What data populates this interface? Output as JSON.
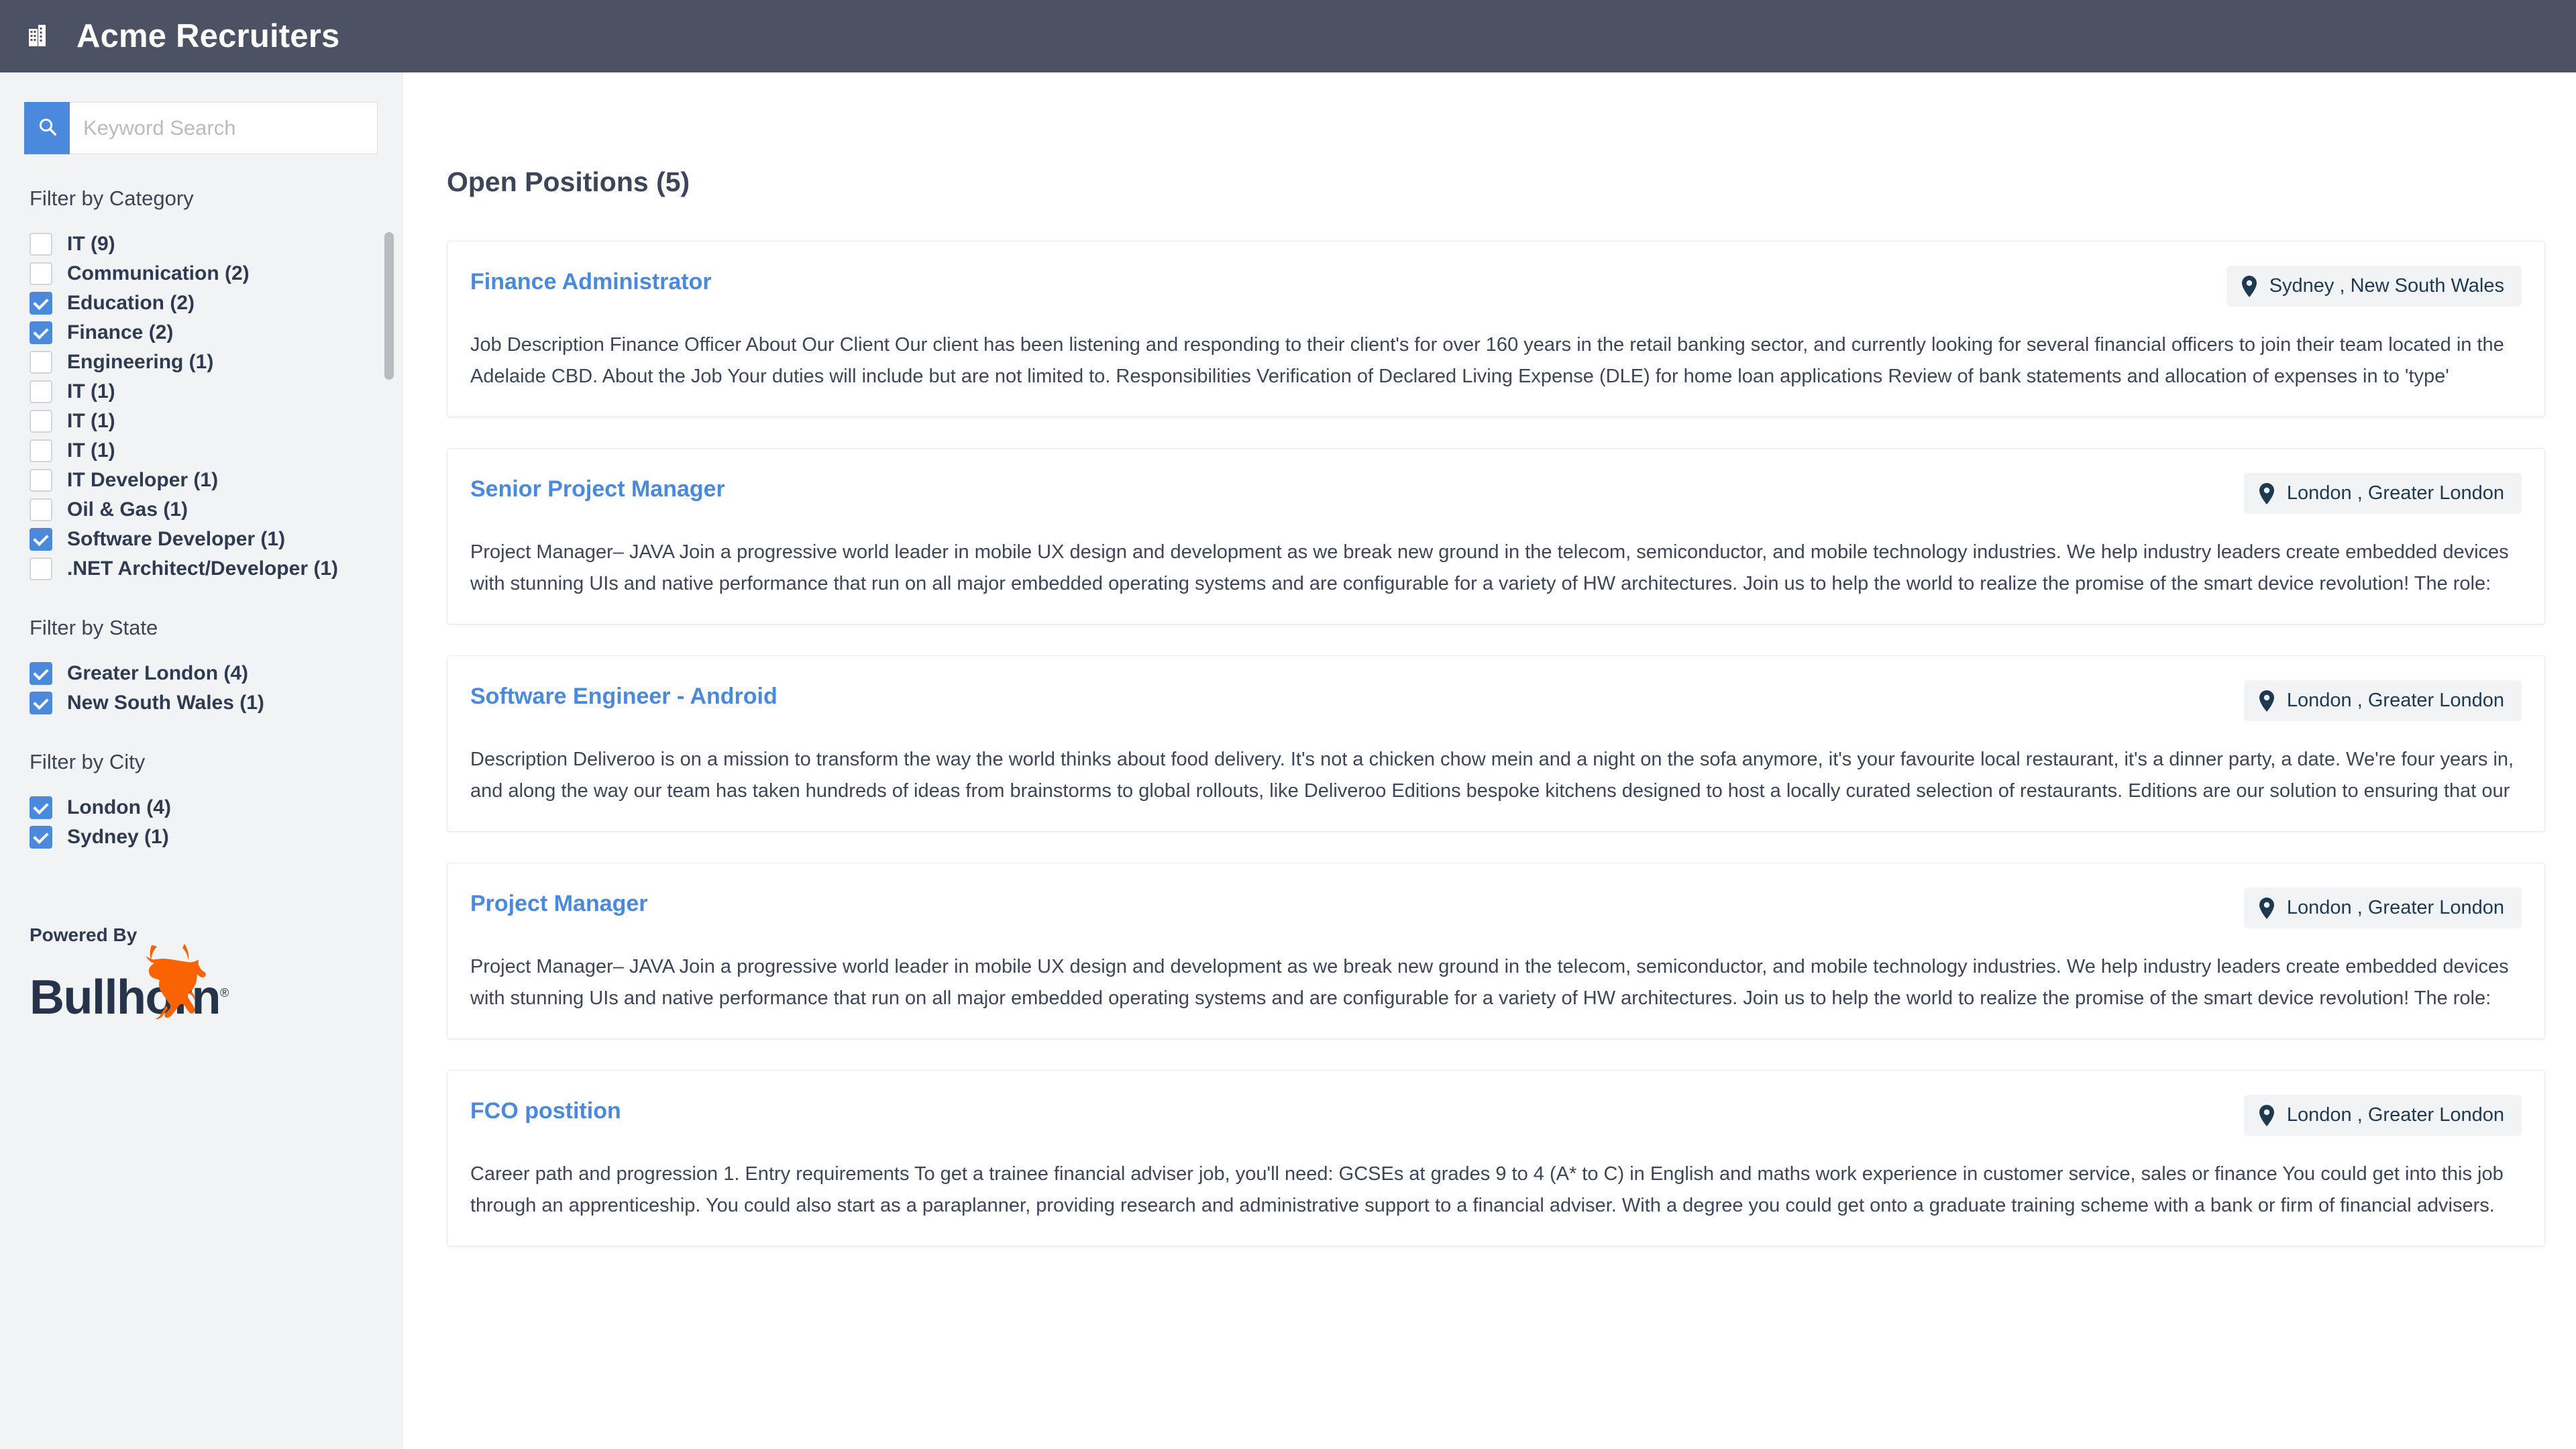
{
  "header": {
    "icon": "building-icon",
    "title": "Acme Recruiters",
    "bg_color": "#4c5264"
  },
  "sidebar": {
    "search": {
      "placeholder": "Keyword Search",
      "value": "",
      "icon": "search-icon",
      "button_color": "#4a89dc"
    },
    "category_filter": {
      "heading": "Filter by Category",
      "items": [
        {
          "label": "IT (9)",
          "checked": false
        },
        {
          "label": "Communication (2)",
          "checked": false
        },
        {
          "label": "Education (2)",
          "checked": true
        },
        {
          "label": "Finance (2)",
          "checked": true
        },
        {
          "label": "Engineering (1)",
          "checked": false
        },
        {
          "label": "IT (1)",
          "checked": false
        },
        {
          "label": "IT (1)",
          "checked": false
        },
        {
          "label": "IT (1)",
          "checked": false
        },
        {
          "label": "IT Developer (1)",
          "checked": false
        },
        {
          "label": "Oil & Gas (1)",
          "checked": false
        },
        {
          "label": "Software Developer (1)",
          "checked": true
        },
        {
          "label": ".NET Architect/Developer (1)",
          "checked": false
        }
      ]
    },
    "state_filter": {
      "heading": "Filter by State",
      "items": [
        {
          "label": "Greater London (4)",
          "checked": true
        },
        {
          "label": "New South Wales (1)",
          "checked": true
        }
      ]
    },
    "city_filter": {
      "heading": "Filter by City",
      "items": [
        {
          "label": "London (4)",
          "checked": true
        },
        {
          "label": "Sydney (1)",
          "checked": true
        }
      ]
    },
    "branding": {
      "powered_by": "Powered By",
      "brand": "Bullhorn",
      "registered_mark": "®",
      "mark_color": "#f96302",
      "word_color": "#26344b"
    }
  },
  "main": {
    "title": "Open Positions (5)",
    "jobs": [
      {
        "title": "Finance Administrator",
        "location_city": "Sydney ,",
        "location_state": "New South Wales",
        "description": "Job Description Finance Officer About Our Client Our client has been listening and responding to their client's for over 160 years in the retail banking sector, and currently looking for several financial officers to join their team located in the Adelaide CBD. About the Job Your duties will include but are not limited to. Responsibilities Verification of Declared Living Expense (DLE) for home loan applications Review of bank statements and allocation of expenses in to 'type' Flagging of actual expenses falling below estimated living"
      },
      {
        "title": "Senior Project Manager",
        "location_city": "London ,",
        "location_state": "Greater London",
        "description": "Project Manager– JAVA Join a progressive world leader in mobile UX design and development as we break new ground in the telecom, semiconductor, and mobile technology industries. We help industry leaders create embedded devices with stunning UIs and native performance that run on all major embedded operating systems and are configurable for a variety of HW architectures. Join us to help the world to realize the promise of the smart device revolution! The role: Our Project Manager (Embedded Systems)"
      },
      {
        "title": "Software Engineer - Android",
        "location_city": "London ,",
        "location_state": "Greater London",
        "description": "Description Deliveroo is on a mission to transform the way the world thinks about food delivery. It's not a chicken chow mein and a night on the sofa anymore, it's your favourite local restaurant, it's a dinner party, a date. We're four years in, and along the way our team has taken hundreds of ideas from brainstorms to global rollouts, like Deliveroo Editions bespoke kitchens designed to host a locally curated selection of restaurants. Editions are our solution to ensuring that our customers have access to the best of the food"
      },
      {
        "title": "Project Manager",
        "location_city": "London ,",
        "location_state": "Greater London",
        "description": "Project Manager– JAVA Join a progressive world leader in mobile UX design and development as we break new ground in the telecom, semiconductor, and mobile technology industries. We help industry leaders create embedded devices with stunning UIs and native performance that run on all major embedded operating systems and are configurable for a variety of HW architectures. Join us to help the world to realize the promise of the smart device revolution! The role: Our Project Manager (Embedded Systems)"
      },
      {
        "title": "FCO postition",
        "location_city": "London ,",
        "location_state": "Greater London",
        "description": "Career path and progression 1. Entry requirements To get a trainee financial adviser job, you'll need: GCSEs at grades 9 to 4 (A* to C) in English and maths work experience in customer service, sales or finance You could get into this job through an apprenticeship. You could also start as a paraplanner, providing research and administrative support to a financial adviser. With a degree you could get onto a graduate training scheme with a bank or firm of financial advisers. You'll also need a qualification in financial advice that's"
      }
    ]
  }
}
